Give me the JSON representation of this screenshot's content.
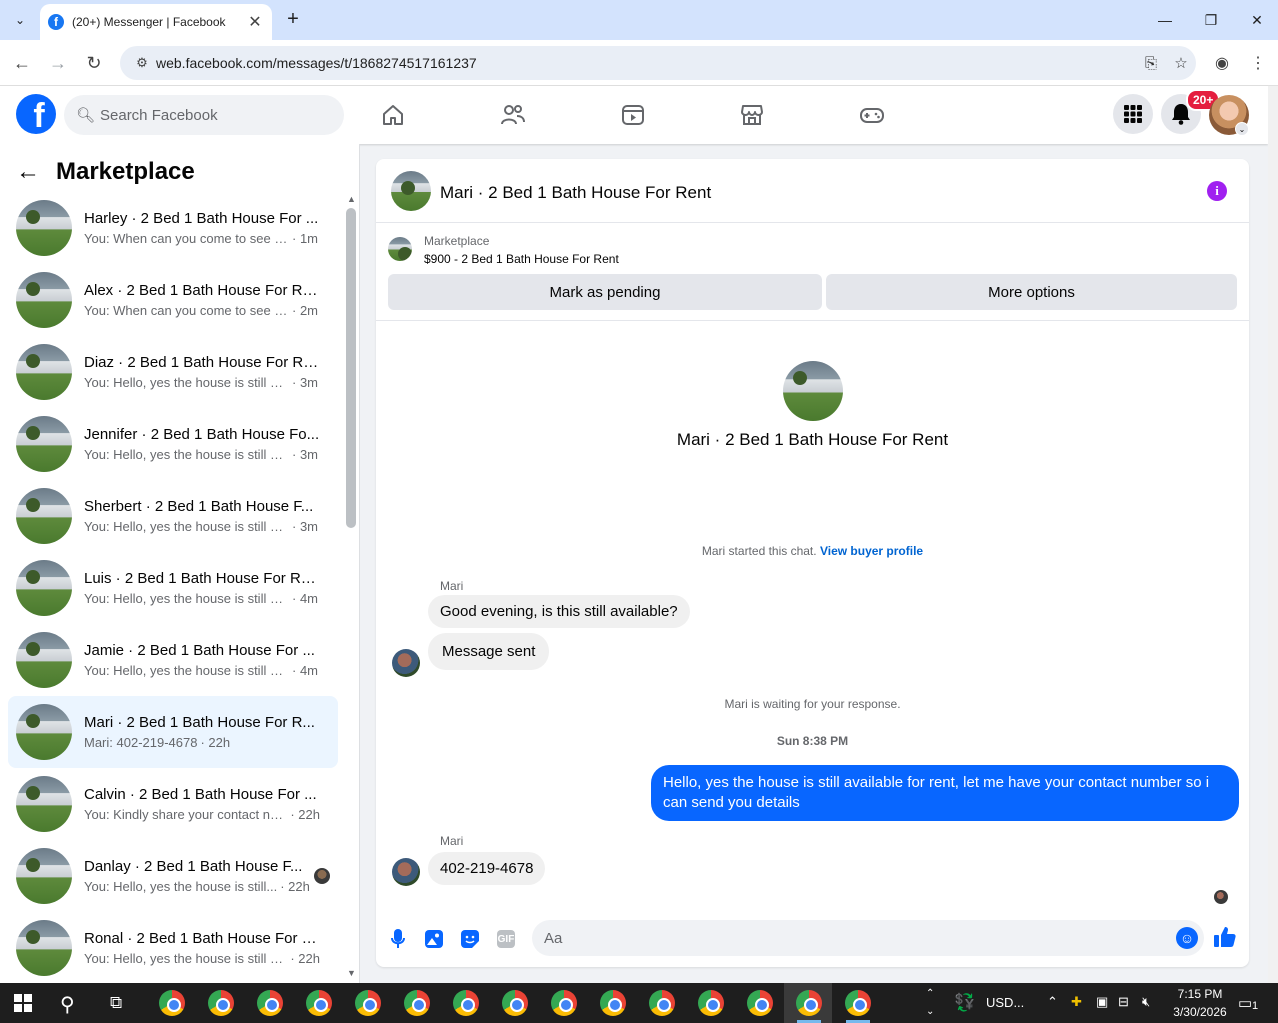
{
  "browser": {
    "tab_title": "(20+) Messenger | Facebook",
    "url": "web.facebook.com/messages/t/1868274517161237"
  },
  "header": {
    "search_placeholder": "Search Facebook",
    "notification_badge": "20+",
    "nav_icons": [
      "home-icon",
      "friends-icon",
      "video-icon",
      "marketplace-icon",
      "gaming-icon"
    ],
    "accent_color": "#0866ff"
  },
  "sidebar": {
    "title": "Marketplace",
    "conversations": [
      {
        "name": "Harley · 2 Bed 1 Bath House For ...",
        "snippet": "You: When can you come to see th...",
        "time": "· 1m"
      },
      {
        "name": "Alex · 2 Bed 1 Bath House For Re...",
        "snippet": "You: When can you come to see th...",
        "time": "· 2m"
      },
      {
        "name": "Diaz · 2 Bed 1 Bath House For Re...",
        "snippet": "You: Hello, yes the house is still av...",
        "time": "· 3m"
      },
      {
        "name": "Jennifer · 2 Bed 1 Bath House Fo...",
        "snippet": "You: Hello, yes the house is still av...",
        "time": "· 3m"
      },
      {
        "name": "Sherbert · 2 Bed 1 Bath House F...",
        "snippet": "You: Hello, yes the house is still av...",
        "time": "· 3m"
      },
      {
        "name": "Luis · 2 Bed 1 Bath House For Rent",
        "snippet": "You: Hello, yes the house is still av...",
        "time": "· 4m"
      },
      {
        "name": "Jamie · 2 Bed 1 Bath House For ...",
        "snippet": "You: Hello, yes the house is still av...",
        "time": "· 4m"
      },
      {
        "name": "Mari · 2 Bed 1 Bath House For R...",
        "snippet": "Mari: 402-219-4678",
        "time": "· 22h"
      },
      {
        "name": "Calvin · 2 Bed 1 Bath House For ...",
        "snippet": "You: Kindly share your contact nu...",
        "time": "· 22h"
      },
      {
        "name": "Danlay · 2 Bed 1 Bath House F...",
        "snippet": "You: Hello, yes the house is still...",
        "time": "· 22h"
      },
      {
        "name": "Ronal · 2 Bed 1 Bath House For R...",
        "snippet": "You: Hello, yes the house is still av...",
        "time": "· 22h"
      }
    ]
  },
  "chat": {
    "title": "Mari · 2 Bed 1 Bath House For Rent",
    "marketplace_label": "Marketplace",
    "listing": "$900 - 2 Bed 1 Bath House For Rent",
    "mark_pending": "Mark as pending",
    "more_options": "More options",
    "started_text": "Mari started this chat.",
    "view_profile": "View buyer profile",
    "sender1": "Mari",
    "msg1": "Good evening, is this still available?",
    "msg2": "Message sent",
    "waiting": "Mari is waiting for your response.",
    "timestamp": "Sun 8:38 PM",
    "msg_out": "Hello, yes the house is still available for rent, let me have your contact number so i can send you  details",
    "sender2": "Mari",
    "msg3": "402-219-4678",
    "input_placeholder": "Aa"
  },
  "taskbar": {
    "tray_label": "USD...",
    "time": "7:15 PM",
    "date": "3/30/2026",
    "notif_count": "1"
  }
}
